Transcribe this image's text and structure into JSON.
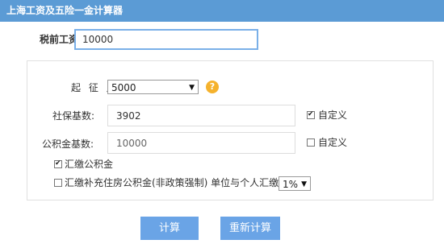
{
  "header": {
    "title": "上海工资及五险一金计算器"
  },
  "salary": {
    "label": "税前工资:",
    "value": "10000"
  },
  "threshold": {
    "label": "起 征 点:",
    "selected": "5000",
    "help_glyph": "?"
  },
  "social_base": {
    "label": "社保基数:",
    "value": "3902",
    "custom_label": "自定义",
    "custom_checked": true
  },
  "fund_base": {
    "label": "公积金基数:",
    "value": "10000",
    "custom_label": "自定义",
    "custom_checked": false
  },
  "pay_fund": {
    "label": "汇缴公积金",
    "checked": true
  },
  "supp_fund": {
    "label": "汇缴补充住房公积金(非政策强制) 单位与个人汇缴比例:",
    "checked": false,
    "ratio_selected": "1%"
  },
  "buttons": {
    "calculate": "计算",
    "recalculate": "重新计算"
  },
  "colors": {
    "header_bg": "#5b9bd5",
    "button_bg": "#6aa4e6",
    "help_icon": "#f5b22d",
    "input_focus_border": "#7ab0e8"
  }
}
